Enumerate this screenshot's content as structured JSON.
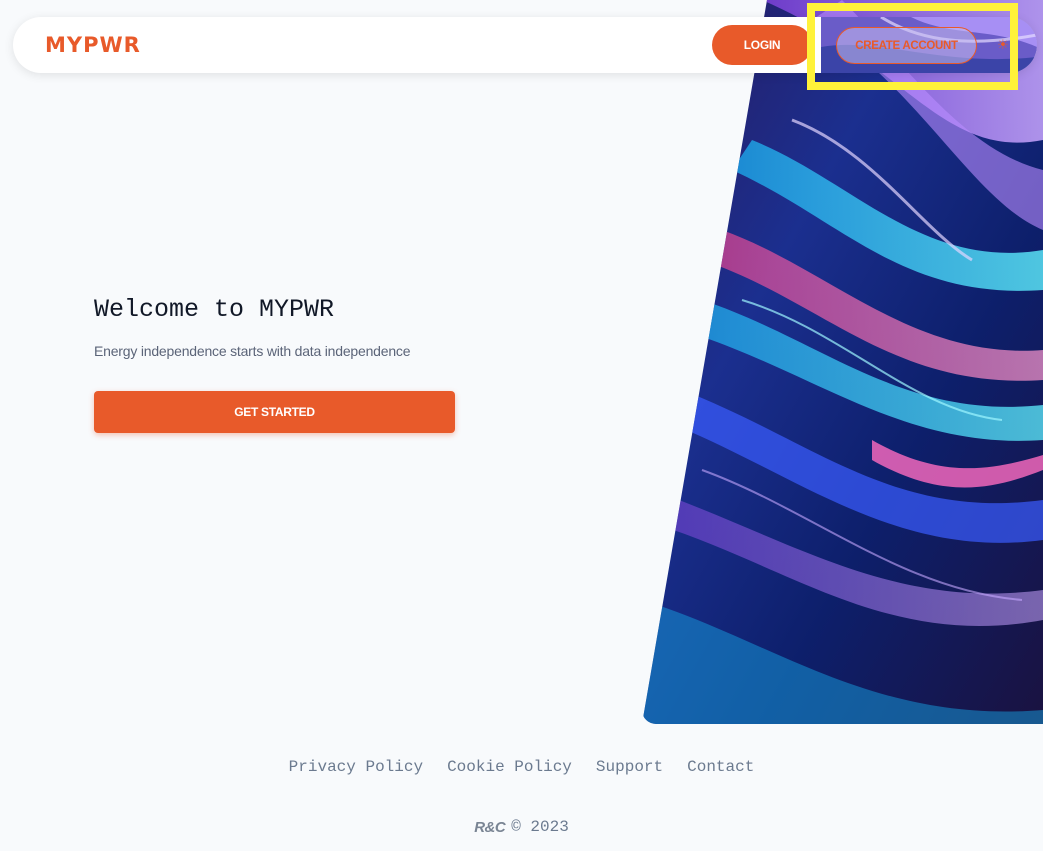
{
  "header": {
    "logo": "MYPWR",
    "login_label": "LOGIN",
    "create_account_label": "CREATE ACCOUNT",
    "theme_icon": "sun-icon"
  },
  "hero": {
    "title": "Welcome to MYPWR",
    "subtitle": "Energy independence starts with data independence",
    "cta_label": "GET STARTED"
  },
  "footer": {
    "links": [
      "Privacy Policy",
      "Cookie Policy",
      "Support",
      "Contact"
    ],
    "brand_mark": "R&C",
    "copyright": "© 2023"
  },
  "colors": {
    "accent": "#e85a2a",
    "background": "#f8fafc",
    "highlight": "#fff23a"
  }
}
